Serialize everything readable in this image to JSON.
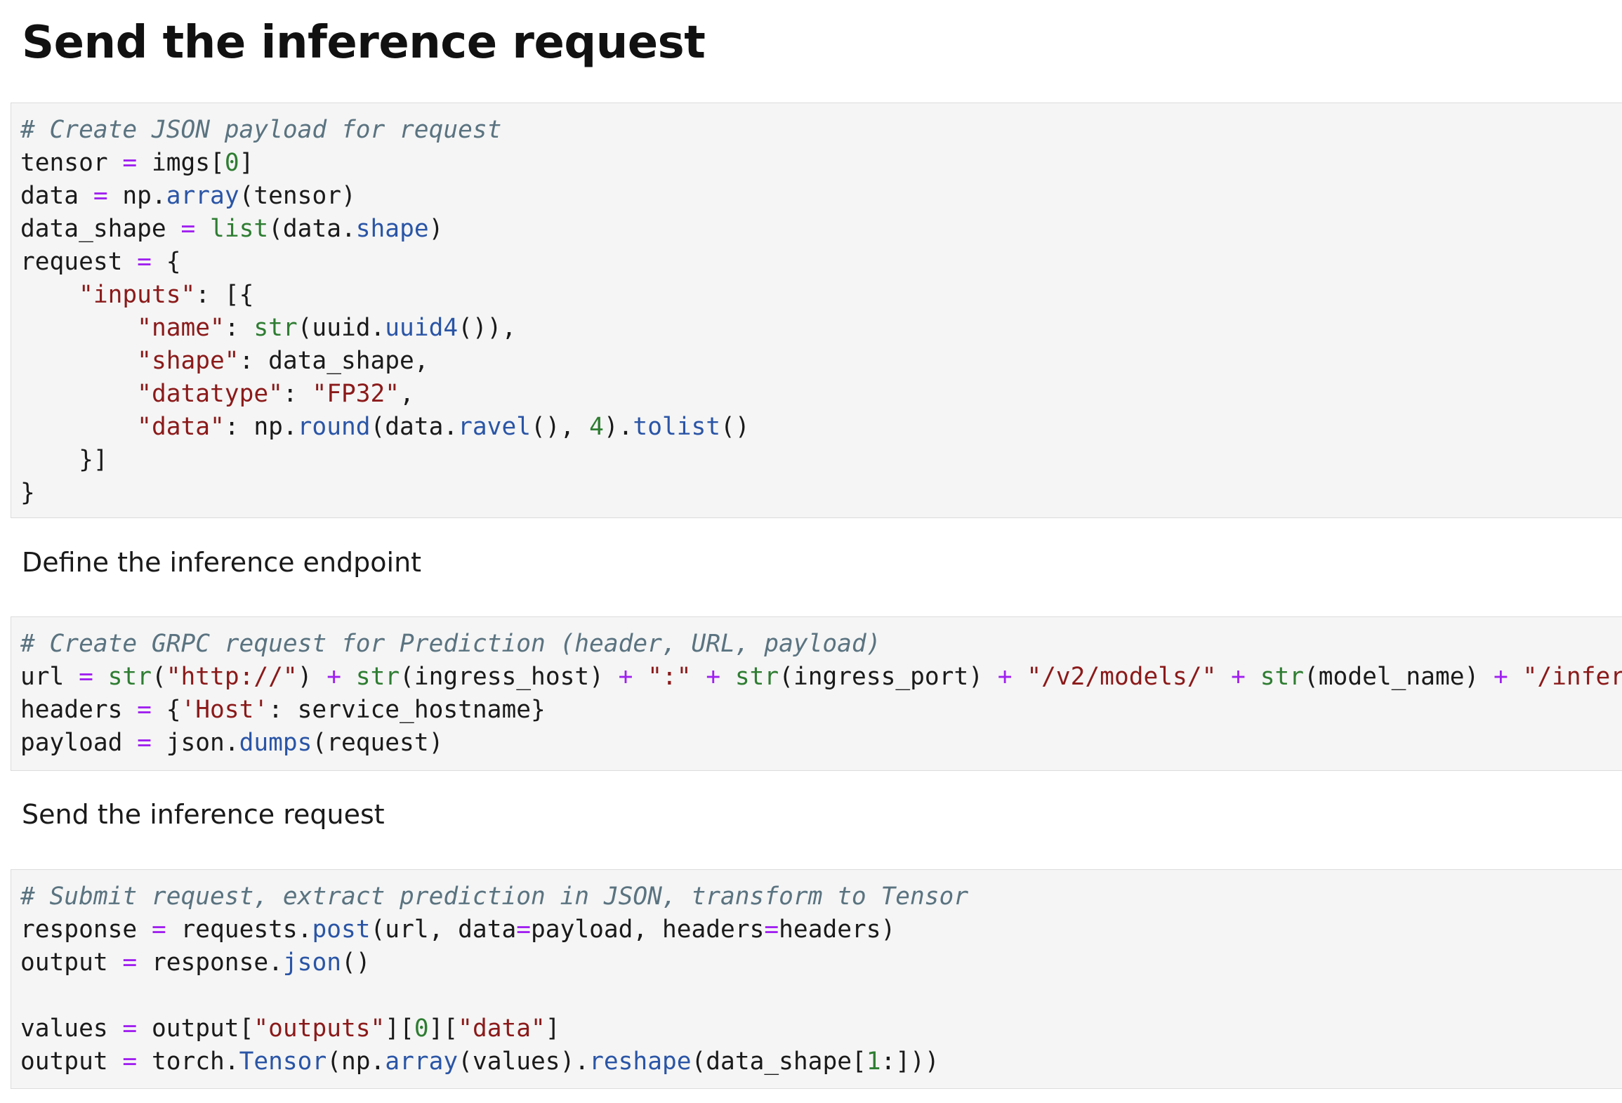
{
  "heading": "Send the inference request",
  "prose": [
    "Define the inference endpoint",
    "Send the inference request"
  ],
  "colors": {
    "comment": "#5a7380",
    "operator": "#a020f0",
    "number": "#2e7d32",
    "string": "#8b1a1a",
    "function": "#2a55a6",
    "builtin": "#2e7d32",
    "cell_background": "#f5f5f5"
  },
  "cells": [
    {
      "lines": [
        [
          {
            "t": "cm",
            "v": "# Create JSON payload for request"
          }
        ],
        [
          {
            "t": "id",
            "v": "tensor "
          },
          {
            "t": "op",
            "v": "="
          },
          {
            "t": "id",
            "v": " imgs["
          },
          {
            "t": "num",
            "v": "0"
          },
          {
            "t": "id",
            "v": "]"
          }
        ],
        [
          {
            "t": "id",
            "v": "data "
          },
          {
            "t": "op",
            "v": "="
          },
          {
            "t": "id",
            "v": " np."
          },
          {
            "t": "fn",
            "v": "array"
          },
          {
            "t": "id",
            "v": "(tensor)"
          }
        ],
        [
          {
            "t": "id",
            "v": "data_shape "
          },
          {
            "t": "op",
            "v": "="
          },
          {
            "t": "id",
            "v": " "
          },
          {
            "t": "bi",
            "v": "list"
          },
          {
            "t": "id",
            "v": "(data."
          },
          {
            "t": "fn",
            "v": "shape"
          },
          {
            "t": "id",
            "v": ")"
          }
        ],
        [
          {
            "t": "id",
            "v": "request "
          },
          {
            "t": "op",
            "v": "="
          },
          {
            "t": "id",
            "v": " {"
          }
        ],
        [
          {
            "t": "id",
            "v": "    "
          },
          {
            "t": "str",
            "v": "\"inputs\""
          },
          {
            "t": "id",
            "v": ": [{"
          }
        ],
        [
          {
            "t": "id",
            "v": "        "
          },
          {
            "t": "str",
            "v": "\"name\""
          },
          {
            "t": "id",
            "v": ": "
          },
          {
            "t": "bi",
            "v": "str"
          },
          {
            "t": "id",
            "v": "(uuid."
          },
          {
            "t": "fn",
            "v": "uuid4"
          },
          {
            "t": "id",
            "v": "()),"
          }
        ],
        [
          {
            "t": "id",
            "v": "        "
          },
          {
            "t": "str",
            "v": "\"shape\""
          },
          {
            "t": "id",
            "v": ": data_shape,"
          }
        ],
        [
          {
            "t": "id",
            "v": "        "
          },
          {
            "t": "str",
            "v": "\"datatype\""
          },
          {
            "t": "id",
            "v": ": "
          },
          {
            "t": "str",
            "v": "\"FP32\""
          },
          {
            "t": "id",
            "v": ","
          }
        ],
        [
          {
            "t": "id",
            "v": "        "
          },
          {
            "t": "str",
            "v": "\"data\""
          },
          {
            "t": "id",
            "v": ": np."
          },
          {
            "t": "fn",
            "v": "round"
          },
          {
            "t": "id",
            "v": "(data."
          },
          {
            "t": "fn",
            "v": "ravel"
          },
          {
            "t": "id",
            "v": "(), "
          },
          {
            "t": "num",
            "v": "4"
          },
          {
            "t": "id",
            "v": ")."
          },
          {
            "t": "fn",
            "v": "tolist"
          },
          {
            "t": "id",
            "v": "()"
          }
        ],
        [
          {
            "t": "id",
            "v": "    }]"
          }
        ],
        [
          {
            "t": "id",
            "v": "}"
          }
        ]
      ]
    },
    {
      "lines": [
        [
          {
            "t": "cm",
            "v": "# Create GRPC request for Prediction (header, URL, payload)"
          }
        ],
        [
          {
            "t": "id",
            "v": "url "
          },
          {
            "t": "op",
            "v": "="
          },
          {
            "t": "id",
            "v": " "
          },
          {
            "t": "bi",
            "v": "str"
          },
          {
            "t": "id",
            "v": "("
          },
          {
            "t": "str",
            "v": "\"http://\""
          },
          {
            "t": "id",
            "v": ") "
          },
          {
            "t": "op",
            "v": "+"
          },
          {
            "t": "id",
            "v": " "
          },
          {
            "t": "bi",
            "v": "str"
          },
          {
            "t": "id",
            "v": "(ingress_host) "
          },
          {
            "t": "op",
            "v": "+"
          },
          {
            "t": "id",
            "v": " "
          },
          {
            "t": "str",
            "v": "\":\""
          },
          {
            "t": "id",
            "v": " "
          },
          {
            "t": "op",
            "v": "+"
          },
          {
            "t": "id",
            "v": " "
          },
          {
            "t": "bi",
            "v": "str"
          },
          {
            "t": "id",
            "v": "(ingress_port) "
          },
          {
            "t": "op",
            "v": "+"
          },
          {
            "t": "id",
            "v": " "
          },
          {
            "t": "str",
            "v": "\"/v2/models/\""
          },
          {
            "t": "id",
            "v": " "
          },
          {
            "t": "op",
            "v": "+"
          },
          {
            "t": "id",
            "v": " "
          },
          {
            "t": "bi",
            "v": "str"
          },
          {
            "t": "id",
            "v": "(model_name) "
          },
          {
            "t": "op",
            "v": "+"
          },
          {
            "t": "id",
            "v": " "
          },
          {
            "t": "str",
            "v": "\"/infer\""
          }
        ],
        [
          {
            "t": "id",
            "v": "headers "
          },
          {
            "t": "op",
            "v": "="
          },
          {
            "t": "id",
            "v": " {"
          },
          {
            "t": "str",
            "v": "'Host'"
          },
          {
            "t": "id",
            "v": ": service_hostname}"
          }
        ],
        [
          {
            "t": "id",
            "v": "payload "
          },
          {
            "t": "op",
            "v": "="
          },
          {
            "t": "id",
            "v": " json."
          },
          {
            "t": "fn",
            "v": "dumps"
          },
          {
            "t": "id",
            "v": "(request)"
          }
        ]
      ]
    },
    {
      "lines": [
        [
          {
            "t": "cm",
            "v": "# Submit request, extract prediction in JSON, transform to Tensor"
          }
        ],
        [
          {
            "t": "id",
            "v": "response "
          },
          {
            "t": "op",
            "v": "="
          },
          {
            "t": "id",
            "v": " requests."
          },
          {
            "t": "fn",
            "v": "post"
          },
          {
            "t": "id",
            "v": "(url, data"
          },
          {
            "t": "op",
            "v": "="
          },
          {
            "t": "id",
            "v": "payload, headers"
          },
          {
            "t": "op",
            "v": "="
          },
          {
            "t": "id",
            "v": "headers)"
          }
        ],
        [
          {
            "t": "id",
            "v": "output "
          },
          {
            "t": "op",
            "v": "="
          },
          {
            "t": "id",
            "v": " response."
          },
          {
            "t": "fn",
            "v": "json"
          },
          {
            "t": "id",
            "v": "()"
          }
        ],
        [
          {
            "t": "id",
            "v": " "
          }
        ],
        [
          {
            "t": "id",
            "v": "values "
          },
          {
            "t": "op",
            "v": "="
          },
          {
            "t": "id",
            "v": " output["
          },
          {
            "t": "str",
            "v": "\"outputs\""
          },
          {
            "t": "id",
            "v": "]["
          },
          {
            "t": "num",
            "v": "0"
          },
          {
            "t": "id",
            "v": "]["
          },
          {
            "t": "str",
            "v": "\"data\""
          },
          {
            "t": "id",
            "v": "]"
          }
        ],
        [
          {
            "t": "id",
            "v": "output "
          },
          {
            "t": "op",
            "v": "="
          },
          {
            "t": "id",
            "v": " torch."
          },
          {
            "t": "fn",
            "v": "Tensor"
          },
          {
            "t": "id",
            "v": "(np."
          },
          {
            "t": "fn",
            "v": "array"
          },
          {
            "t": "id",
            "v": "(values)."
          },
          {
            "t": "fn",
            "v": "reshape"
          },
          {
            "t": "id",
            "v": "(data_shape["
          },
          {
            "t": "num",
            "v": "1"
          },
          {
            "t": "id",
            "v": ":]))"
          }
        ]
      ]
    }
  ]
}
